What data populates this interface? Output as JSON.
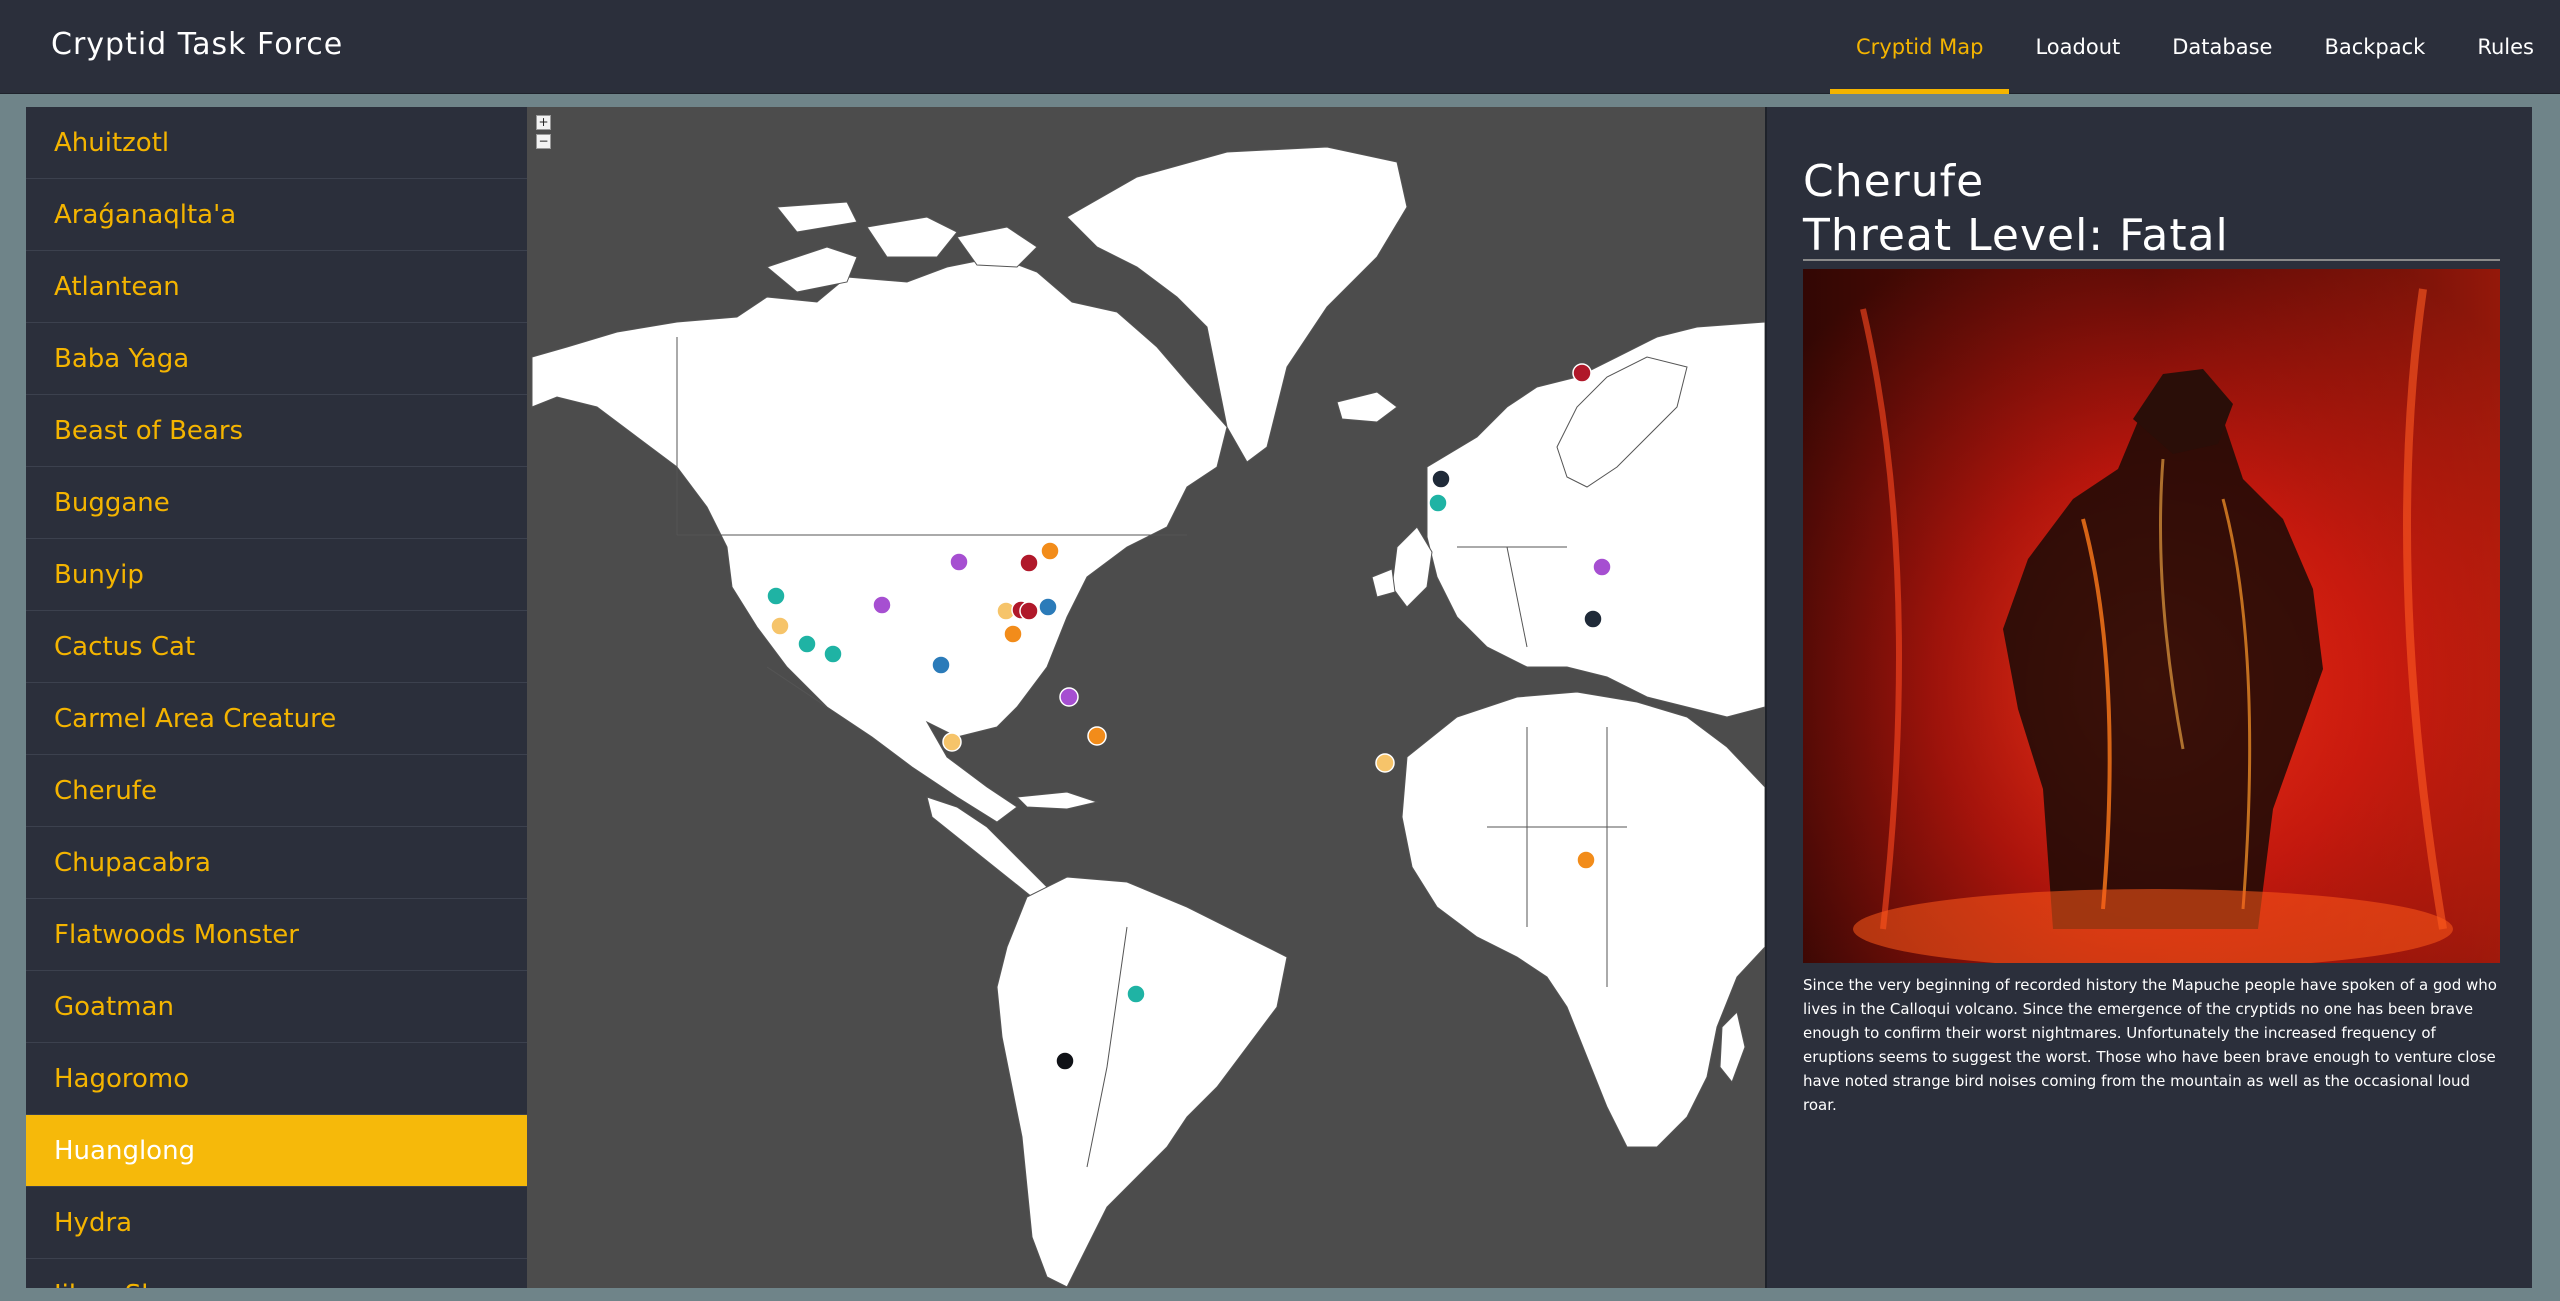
{
  "app": {
    "title": "Cryptid Task Force"
  },
  "nav": {
    "items": [
      {
        "label": "Cryptid Map",
        "active": true
      },
      {
        "label": "Loadout",
        "active": false
      },
      {
        "label": "Database",
        "active": false
      },
      {
        "label": "Backpack",
        "active": false
      },
      {
        "label": "Rules",
        "active": false
      }
    ]
  },
  "sidebar": {
    "items": [
      {
        "label": "Ahuitzotl"
      },
      {
        "label": "Araǵanaqlta'a"
      },
      {
        "label": "Atlantean"
      },
      {
        "label": "Baba Yaga"
      },
      {
        "label": "Beast of Bears"
      },
      {
        "label": "Buggane"
      },
      {
        "label": "Bunyip"
      },
      {
        "label": "Cactus Cat"
      },
      {
        "label": "Carmel Area Creature"
      },
      {
        "label": "Cherufe"
      },
      {
        "label": "Chupacabra"
      },
      {
        "label": "Flatwoods Monster"
      },
      {
        "label": "Goatman"
      },
      {
        "label": "Hagoromo"
      },
      {
        "label": "Huanglong",
        "active": true
      },
      {
        "label": "Hydra"
      },
      {
        "label": "Jikon-Sh..."
      }
    ]
  },
  "map": {
    "zoom_in_label": "+",
    "zoom_out_label": "−",
    "ocean_color": "#4c4c4c",
    "land_color": "#ffffff",
    "marker_colors": {
      "red": "#b0182a",
      "orange": "#f28c1a",
      "yellow": "#f6c46a",
      "teal": "#1fb3a4",
      "purple": "#a64fd1",
      "blue": "#2b7bb9",
      "black": "#101217",
      "navy": "#1f2a38"
    }
  },
  "detail": {
    "name": "Cherufe",
    "threat_line": "Threat Level: Fatal",
    "description": "Since the very beginning of recorded history the Mapuche people have spoken of a god who lives in the Calloqui volcano. Since the emergence of the cryptids no one has been brave enough to confirm their worst nightmares. Unfortunately the increased frequency of eruptions seems to suggest the worst. Those who have been brave enough to venture close have noted strange bird noises coming from the mountain as well as the occasional loud roar."
  },
  "colors": {
    "accent": "#f4b400",
    "panel": "#2b2f3b",
    "page_bg": "#6f8489"
  }
}
